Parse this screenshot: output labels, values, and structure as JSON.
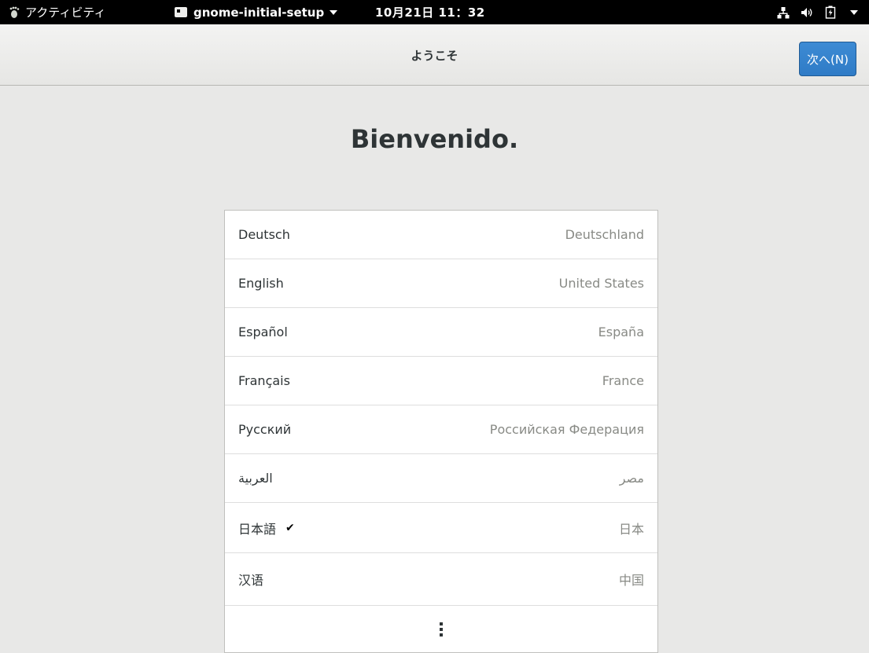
{
  "topbar": {
    "activities_label": "アクティビティ",
    "app_menu_label": "gnome-initial-setup",
    "clock": "10月21日 11：32"
  },
  "header": {
    "title": "ようこそ",
    "next_button": "次へ(N)"
  },
  "main": {
    "welcome_text": "Bienvenido.",
    "languages": [
      {
        "language": "Deutsch",
        "country": "Deutschland",
        "selected": false
      },
      {
        "language": "English",
        "country": "United States",
        "selected": false
      },
      {
        "language": "Español",
        "country": "España",
        "selected": false
      },
      {
        "language": "Français",
        "country": "France",
        "selected": false
      },
      {
        "language": "Русский",
        "country": "Российская Федерация",
        "selected": false
      },
      {
        "language": "العربية",
        "country": "مصر",
        "selected": false
      },
      {
        "language": "日本語",
        "country": "日本",
        "selected": true
      },
      {
        "language": "汉语",
        "country": "中国",
        "selected": false
      }
    ],
    "check_mark": "✔"
  },
  "colors": {
    "topbar_bg": "#000000",
    "accent": "#2f7bc6",
    "window_bg": "#e8e8e7"
  },
  "icons": [
    "foot-icon",
    "window-icon",
    "network-icon",
    "volume-icon",
    "battery-icon",
    "menu-arrow-icon",
    "more-icon",
    "check-icon"
  ]
}
